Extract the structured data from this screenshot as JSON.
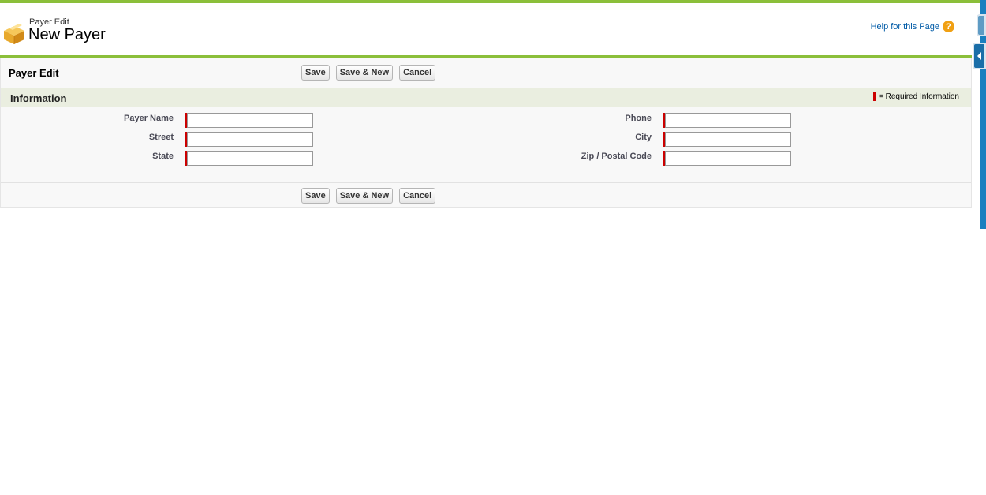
{
  "header": {
    "subtitle": "Payer Edit",
    "title": "New Payer",
    "help_label": "Help for this Page",
    "help_icon": "question-icon"
  },
  "panel": {
    "edit_title": "Payer Edit",
    "buttons": {
      "save": "Save",
      "save_new": "Save & New",
      "cancel": "Cancel"
    }
  },
  "section": {
    "title": "Information",
    "required_legend": "= Required Information"
  },
  "fields": {
    "payer_name": {
      "label": "Payer Name",
      "value": ""
    },
    "street": {
      "label": "Street",
      "value": ""
    },
    "state": {
      "label": "State",
      "value": ""
    },
    "phone": {
      "label": "Phone",
      "value": ""
    },
    "city": {
      "label": "City",
      "value": ""
    },
    "zip": {
      "label": "Zip / Postal Code",
      "value": ""
    }
  },
  "colors": {
    "accent_green": "#8bbf3a",
    "required_red": "#cc0000",
    "link_blue": "#015ba7",
    "section_bg": "#eaeee0"
  }
}
